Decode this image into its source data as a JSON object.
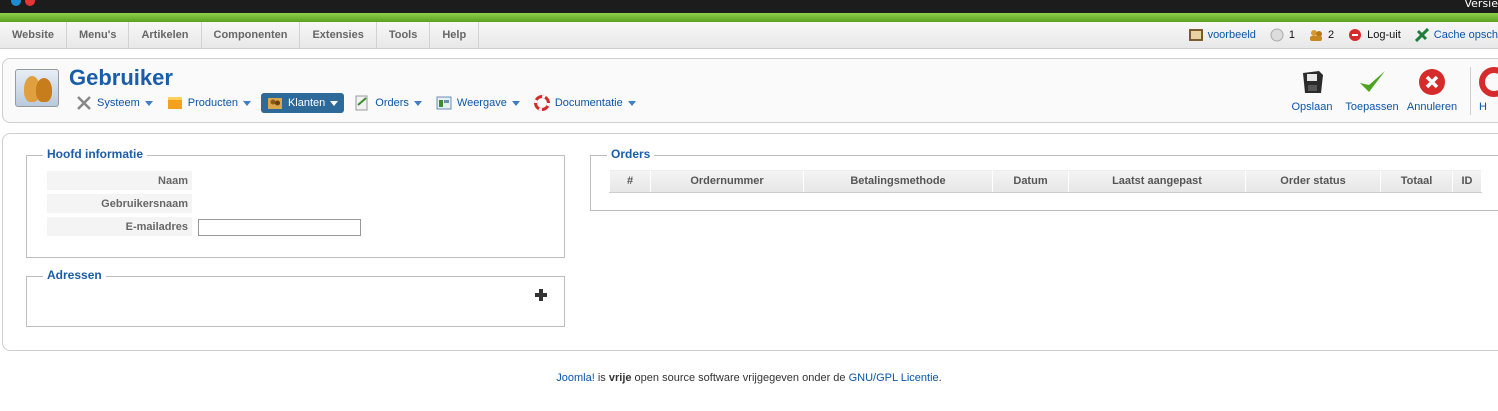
{
  "topbar": {
    "version_text": "Versie"
  },
  "menu": {
    "items": [
      "Website",
      "Menu's",
      "Artikelen",
      "Componenten",
      "Extensies",
      "Tools",
      "Help"
    ]
  },
  "status": {
    "preview": "voorbeeld",
    "messages_count": "1",
    "users_count": "2",
    "logout": "Log-uit",
    "cache": "Cache opsch"
  },
  "header": {
    "title": "Gebruiker",
    "subnav": [
      {
        "label": "Systeem",
        "icon": "tools-icon"
      },
      {
        "label": "Producten",
        "icon": "box-icon"
      },
      {
        "label": "Klanten",
        "icon": "customers-icon",
        "active": true
      },
      {
        "label": "Orders",
        "icon": "orders-icon"
      },
      {
        "label": "Weergave",
        "icon": "display-icon"
      },
      {
        "label": "Documentatie",
        "icon": "lifebuoy-icon"
      }
    ],
    "toolbar": {
      "save": "Opslaan",
      "apply": "Toepassen",
      "cancel": "Annuleren",
      "help": "H"
    }
  },
  "main_info": {
    "legend": "Hoofd informatie",
    "name_label": "Naam",
    "username_label": "Gebruikersnaam",
    "email_label": "E-mailadres",
    "email_value": ""
  },
  "addresses": {
    "legend": "Adressen"
  },
  "orders": {
    "legend": "Orders",
    "columns": [
      "#",
      "Ordernummer",
      "Betalingsmethode",
      "Datum",
      "Laatst aangepast",
      "Order status",
      "Totaal",
      "ID"
    ]
  },
  "footer": {
    "joomla": "Joomla!",
    "is": " is ",
    "vrije": "vrije",
    "middle": " open source software vrijgegeven onder de ",
    "license": "GNU/GPL Licentie",
    "end": "."
  },
  "colors": {
    "accent": "#1b5da8",
    "link": "#0b55a8",
    "green": "#6cb52b"
  }
}
